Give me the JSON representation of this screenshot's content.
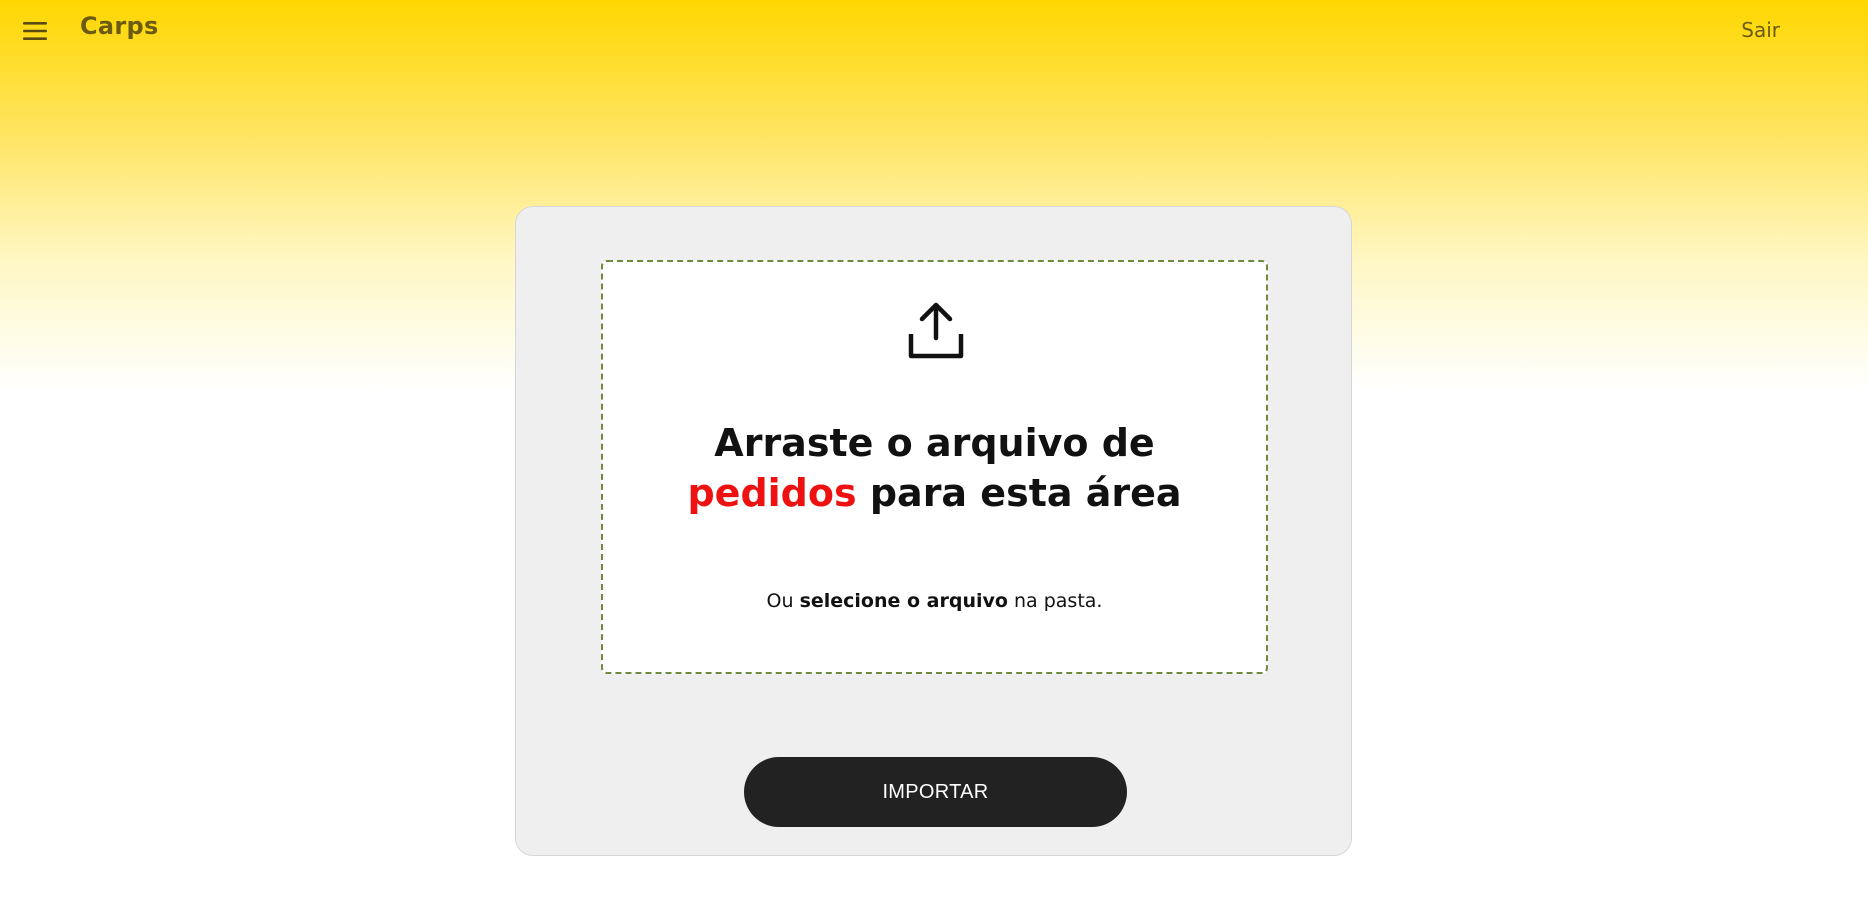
{
  "header": {
    "brand": "Carps",
    "logout_label": "Sair",
    "menu_icon": "menu-icon"
  },
  "upload": {
    "icon": "upload-icon",
    "title_line1": "Arraste o arquivo de",
    "title_highlight": "pedidos",
    "title_line2_rest": "para esta área",
    "sub_prefix": "Ou",
    "sub_bold": "selecione o arquivo",
    "sub_suffix": "na pasta."
  },
  "actions": {
    "import_label": "IMPORTAR"
  },
  "colors": {
    "header_gradient_top": "#ffd700",
    "brand_text": "#6b5b10",
    "highlight": "#ee1111",
    "button_bg": "#222222",
    "dropzone_border": "#6f8a3a",
    "card_bg": "#efefef"
  }
}
